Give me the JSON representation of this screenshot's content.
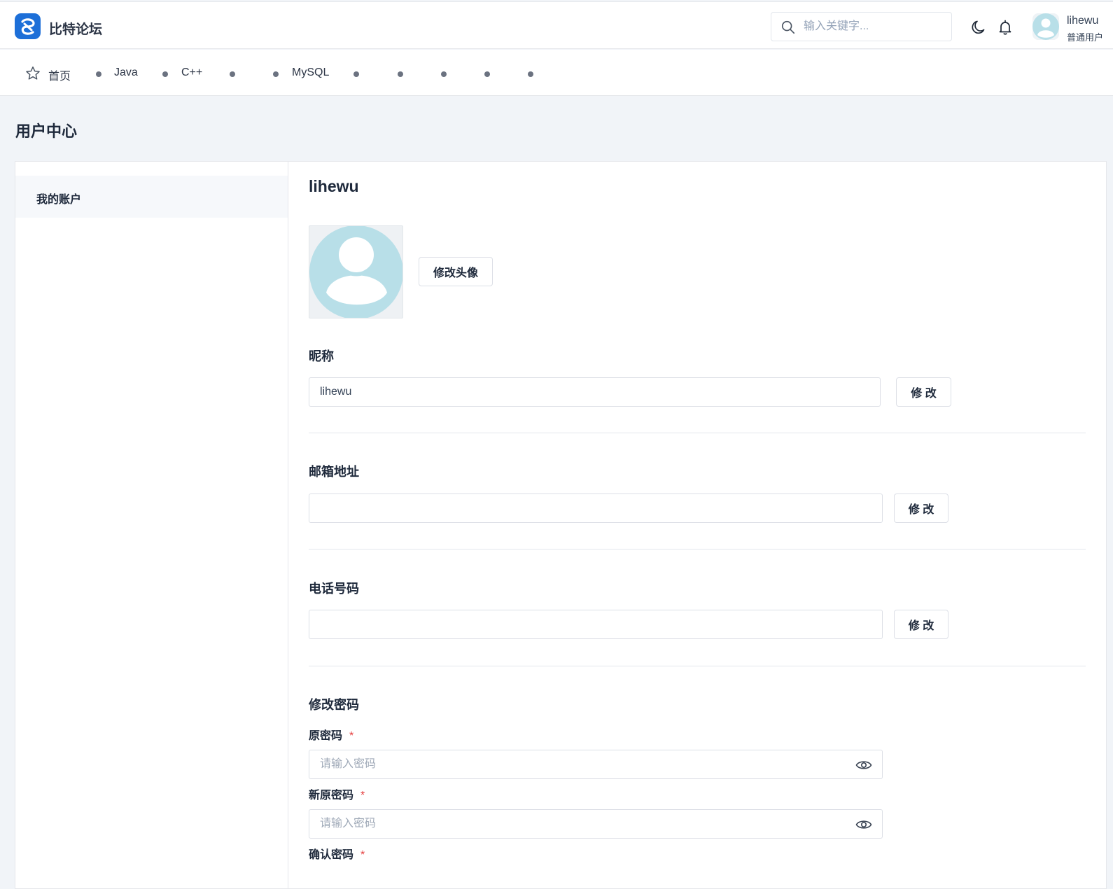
{
  "header": {
    "brand": "比特论坛",
    "search": {
      "placeholder": "输入关键字..."
    },
    "user": {
      "name": "lihewu",
      "role": "普通用户"
    }
  },
  "nav": {
    "items": [
      {
        "label": "首页",
        "icon": "star-icon"
      },
      {
        "label": "Java"
      },
      {
        "label": "C++"
      },
      {
        "label": ""
      },
      {
        "label": "MySQL"
      },
      {
        "label": ""
      },
      {
        "label": ""
      },
      {
        "label": ""
      },
      {
        "label": ""
      },
      {
        "label": ""
      }
    ]
  },
  "page_title": "用户中心",
  "sidebar": {
    "items": [
      {
        "label": "我的账户"
      }
    ]
  },
  "profile": {
    "name": "lihewu",
    "change_avatar": "修改头像",
    "nickname": {
      "label": "昵称",
      "value": "lihewu",
      "button": "修 改"
    },
    "email": {
      "label": "邮箱地址",
      "value": "",
      "button": "修 改"
    },
    "phone": {
      "label": "电话号码",
      "value": "",
      "button": "修 改"
    },
    "password": {
      "title": "修改密码",
      "old_label": "原密码",
      "new_label": "新原密码",
      "confirm_label": "确认密码",
      "required_mark": "*",
      "placeholder": "请输入密码"
    }
  },
  "colors": {
    "accent": "#1d6fd8",
    "avatar": "#b8dfe8",
    "required": "#e53e3e",
    "background": "#f1f4f8"
  }
}
